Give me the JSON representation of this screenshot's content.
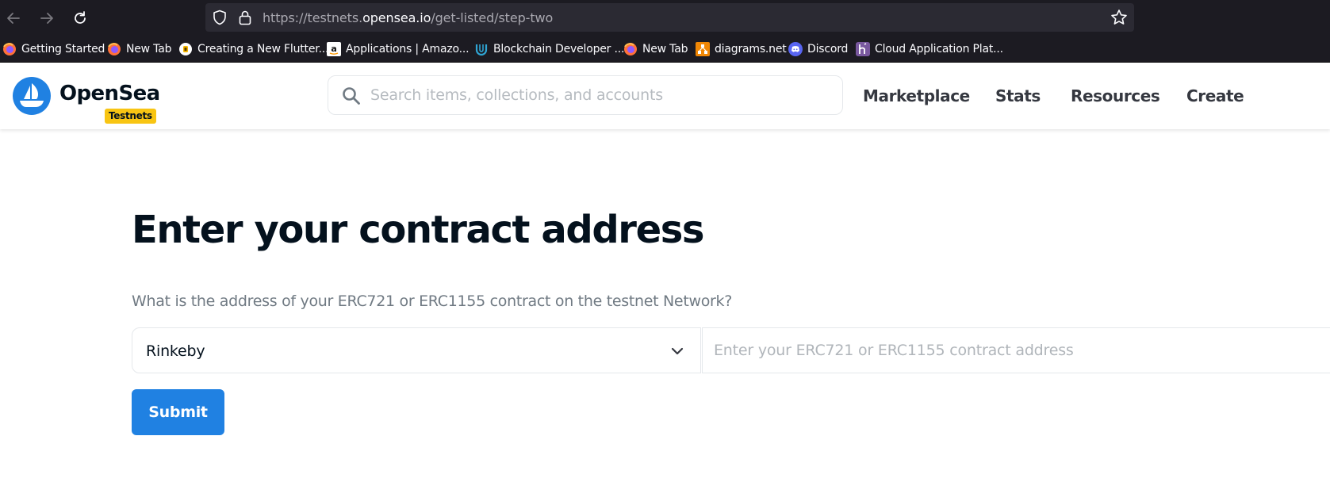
{
  "browser": {
    "url": {
      "prefix": "https://testnets.",
      "host": "opensea.io",
      "path": "/get-listed/step-two"
    },
    "bookmarks": [
      {
        "label": "Getting Started",
        "icon": "firefox-icon"
      },
      {
        "label": "New Tab",
        "icon": "firefox-icon"
      },
      {
        "label": "Creating a New Flutter...",
        "icon": "flutter-icon"
      },
      {
        "label": "Applications | Amazo...",
        "icon": "amazon-icon"
      },
      {
        "label": "Blockchain Developer ...",
        "icon": "udemy-icon"
      },
      {
        "label": "New Tab",
        "icon": "firefox-icon"
      },
      {
        "label": "diagrams.net",
        "icon": "diagrams-icon"
      },
      {
        "label": "Discord",
        "icon": "discord-icon"
      },
      {
        "label": "Cloud Application Plat...",
        "icon": "heroku-icon"
      }
    ]
  },
  "header": {
    "brand": "OpenSea",
    "badge": "Testnets",
    "search_placeholder": "Search items, collections, and accounts",
    "nav": [
      "Marketplace",
      "Stats",
      "Resources",
      "Create"
    ]
  },
  "main": {
    "title": "Enter your contract address",
    "question": "What is the address of your ERC721 or ERC1155 contract on the testnet Network?",
    "network_value": "Rinkeby",
    "address_placeholder": "Enter your ERC721 or ERC1155 contract address",
    "submit_label": "Submit"
  },
  "colors": {
    "accent": "#2081e2",
    "badge": "#f8c513",
    "chrome": "#1c1b22"
  }
}
